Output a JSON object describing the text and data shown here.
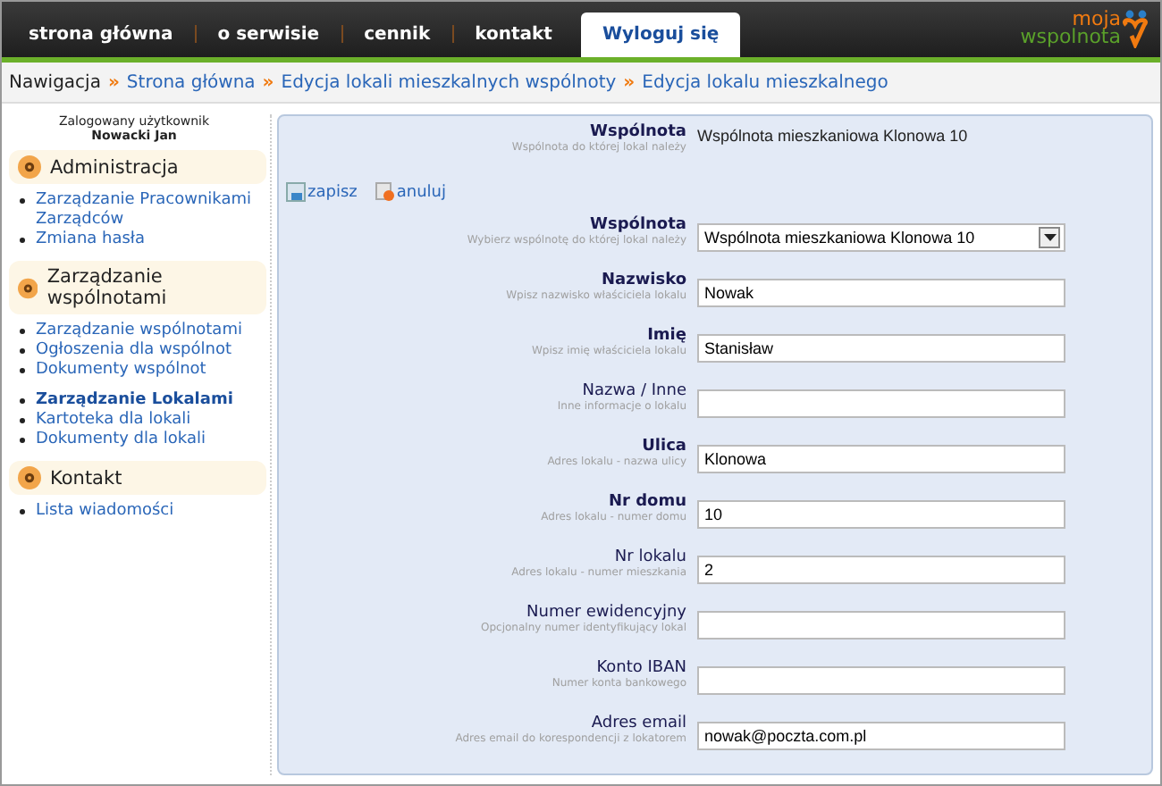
{
  "top_nav": {
    "tabs": [
      {
        "label": "strona główna",
        "selected": false
      },
      {
        "label": "o serwisie",
        "selected": false
      },
      {
        "label": "cennik",
        "selected": false
      },
      {
        "label": "kontakt",
        "selected": false
      },
      {
        "label": "Wyloguj się",
        "selected": true
      }
    ],
    "logo": {
      "line_1": "moja",
      "line_2": "wspolnota"
    }
  },
  "breadcrumb": {
    "lead": "Nawigacja",
    "separator": "»",
    "items": [
      "Strona główna",
      "Edycja lokali mieszkalnych wspólnoty",
      "Edycja lokalu mieszkalnego"
    ]
  },
  "sidebar": {
    "user_caption": "Zalogowany użytkownik",
    "user_name": "Nowacki Jan",
    "sections": [
      {
        "title": "Administracja",
        "groups": [
          [
            {
              "label": "Zarządzanie Pracownikami Zarządców",
              "selected": false
            },
            {
              "label": "Zmiana hasła",
              "selected": false
            }
          ]
        ]
      },
      {
        "title": "Zarządzanie wspólnotami",
        "groups": [
          [
            {
              "label": "Zarządzanie wspólnotami",
              "selected": false
            },
            {
              "label": "Ogłoszenia dla wspólnot",
              "selected": false
            },
            {
              "label": "Dokumenty wspólnot",
              "selected": false
            }
          ],
          [
            {
              "label": "Zarządzanie Lokalami",
              "selected": true
            },
            {
              "label": "Kartoteka dla lokali",
              "selected": false
            },
            {
              "label": "Dokumenty dla lokali",
              "selected": false
            }
          ]
        ]
      },
      {
        "title": "Kontakt",
        "groups": [
          [
            {
              "label": "Lista wiadomości",
              "selected": false
            }
          ]
        ]
      }
    ]
  },
  "form": {
    "summary": {
      "label": "Wspólnota",
      "hint": "Wspólnota do której lokal należy",
      "value": "Wspólnota mieszkaniowa Klonowa 10"
    },
    "actions": [
      {
        "kind": "save",
        "label": "zapisz"
      },
      {
        "kind": "cancel",
        "label": "anuluj"
      }
    ],
    "fields": [
      {
        "kind": "select",
        "label": "Wspólnota",
        "hint": "Wybierz wspólnotę do której lokal należy",
        "required": true,
        "value": "Wspólnota mieszkaniowa Klonowa 10"
      },
      {
        "kind": "text",
        "label": "Nazwisko",
        "hint": "Wpisz nazwisko właściciela lokalu",
        "required": true,
        "value": "Nowak"
      },
      {
        "kind": "text",
        "label": "Imię",
        "hint": "Wpisz imię właściciela lokalu",
        "required": true,
        "value": "Stanisław"
      },
      {
        "kind": "text",
        "label": "Nazwa / Inne",
        "hint": "Inne informacje o lokalu",
        "required": false
      },
      {
        "kind": "text",
        "label": "Ulica",
        "hint": "Adres lokalu - nazwa ulicy",
        "required": true,
        "value": "Klonowa"
      },
      {
        "kind": "text",
        "label": "Nr domu",
        "hint": "Adres lokalu - numer domu",
        "required": true,
        "value": "10"
      },
      {
        "kind": "text",
        "label": "Nr lokalu",
        "hint": "Adres lokalu - numer mieszkania",
        "required": false,
        "value": "2"
      },
      {
        "kind": "text",
        "label": "Numer ewidencyjny",
        "hint": "Opcjonalny numer identyfikujący lokal",
        "required": false
      },
      {
        "kind": "text",
        "label": "Konto IBAN",
        "hint": "Numer konta bankowego",
        "required": false
      },
      {
        "kind": "text",
        "label": "Adres email",
        "hint": "Adres email do korespondencji z lokatorem",
        "required": false,
        "value": "nowak@poczta.com.pl"
      }
    ]
  }
}
